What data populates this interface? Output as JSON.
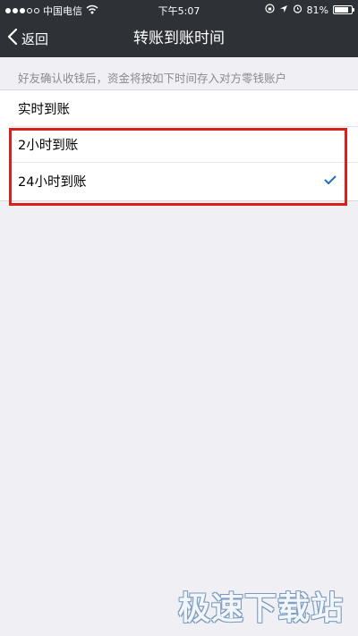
{
  "status_bar": {
    "carrier": "中国电信",
    "time": "下午5:07",
    "battery": "81%",
    "battery_level": 0.81,
    "signal_bars": 3,
    "icons": [
      "wifi-icon",
      "orientation-lock-icon",
      "location-icon",
      "alarm-icon",
      "battery-icon"
    ]
  },
  "nav": {
    "back_label": "返回",
    "title": "转账到账时间"
  },
  "hint": "好友确认收钱后，资金将按如下时间存入对方零钱账户",
  "options": [
    {
      "label": "实时到账",
      "selected": false
    },
    {
      "label": "2小时到账",
      "selected": false
    },
    {
      "label": "24小时到账",
      "selected": true
    }
  ],
  "watermark": "极速下载站",
  "colors": {
    "nav_bg": "#2e3135",
    "page_bg": "#efeff4",
    "check": "#1f6fc5",
    "highlight": "#d9211c"
  }
}
